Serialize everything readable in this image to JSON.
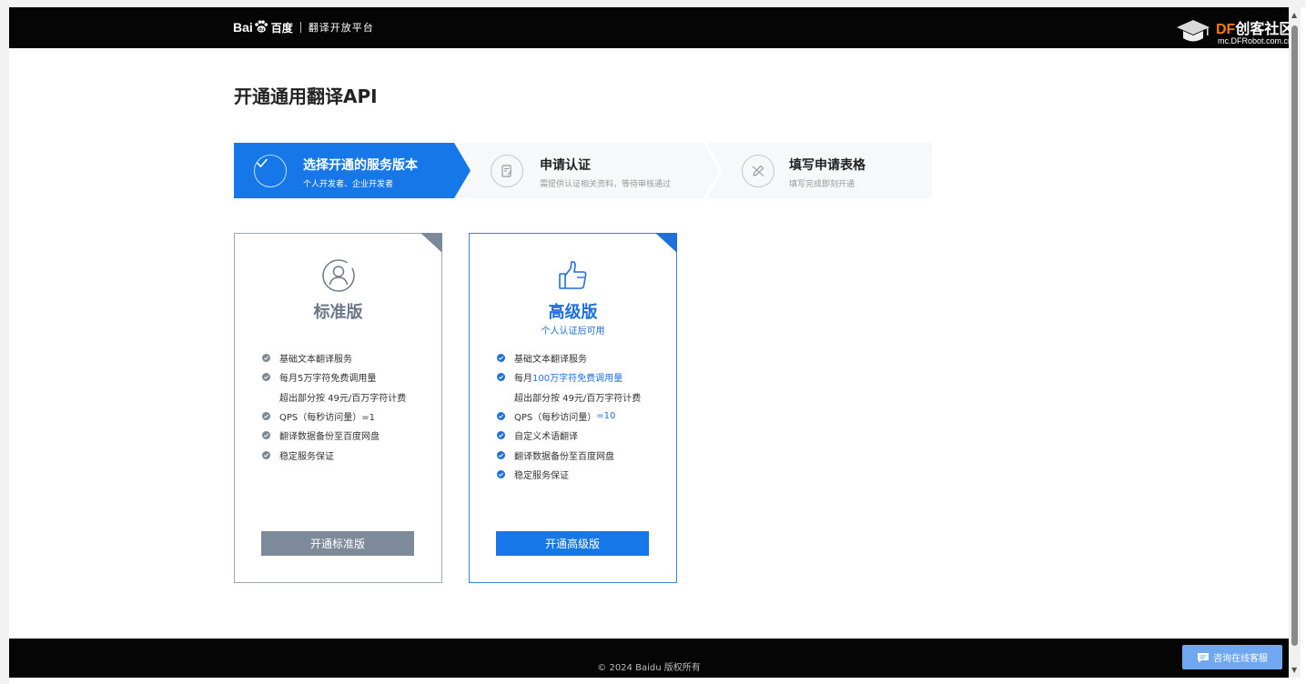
{
  "header": {
    "logo_latin": "Bai",
    "logo_du": "du",
    "logo_cn": "百度",
    "product_title": "翻译开放平台"
  },
  "watermark": {
    "brand_df": "DF",
    "brand_cn": "创客社区",
    "url": "mc.DFRobot.com.cn"
  },
  "page": {
    "title": "开通通用翻译API"
  },
  "steps": [
    {
      "title": "选择开通的服务版本",
      "subtitle": "个人开发者、企业开发者",
      "active": true
    },
    {
      "title": "申请认证",
      "subtitle": "需提供认证相关资料，等待审核通过",
      "active": false
    },
    {
      "title": "填写申请表格",
      "subtitle": "填写完成即刻开通",
      "active": false
    }
  ],
  "plans": {
    "standard": {
      "name": "标准版",
      "features": [
        "基础文本翻译服务",
        "每月5万字符免费调用量",
        "超出部分按 49元/百万字符计费",
        "QPS（每秒访问量）=1",
        "翻译数据备份至百度网盘",
        "稳定服务保证"
      ],
      "button_label": "开通标准版"
    },
    "premium": {
      "name": "高级版",
      "note": "个人认证后可用",
      "features": {
        "f1": "基础文本翻译服务",
        "f2_prefix": "每月",
        "f2_highlight": "100万字符免费调用量",
        "f2_sub": "超出部分按 49元/百万字符计费",
        "f3_prefix": "QPS（每秒访问量）",
        "f3_highlight": "=10",
        "f4": "自定义术语翻译",
        "f5": "翻译数据备份至百度网盘",
        "f6": "稳定服务保证"
      },
      "button_label": "开通高级版"
    }
  },
  "footer": {
    "copyright": "© 2024 Baidu 版权所有",
    "chat_label": "咨询在线客服"
  },
  "colors": {
    "primary": "#1677e8",
    "standard_gray": "#7c8a99",
    "header_bg": "#050505"
  }
}
